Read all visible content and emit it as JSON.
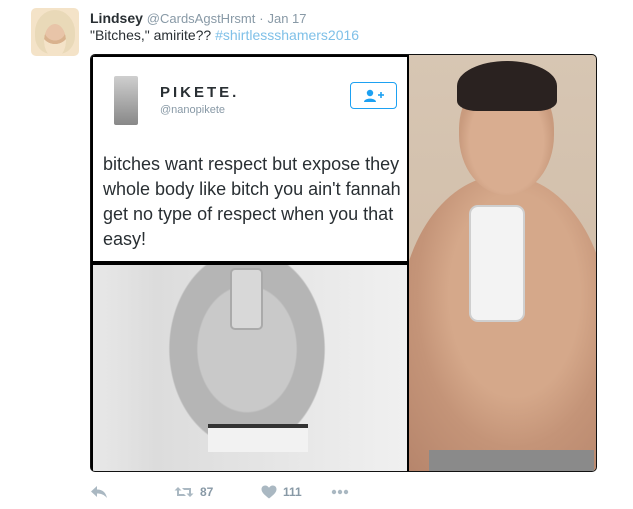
{
  "tweet": {
    "display_name": "Lindsey",
    "handle": "@CardsAgstHrsmt",
    "separator": "·",
    "date": "Jan 17",
    "text": "\"Bitches,\" amirite??",
    "hashtag": "#shirtlessshamers2016"
  },
  "quoted_tweet": {
    "name": "PIKETE.",
    "handle": "@nanopikete",
    "text": "bitches want respect but expose they whole body like bitch you ain't fannah get no type of respect when you that easy!"
  },
  "actions": {
    "retweet_count": "87",
    "like_count": "111"
  },
  "colors": {
    "accent": "#1da1f2",
    "hashtag": "#7fc0e8",
    "muted": "#8899a6",
    "text": "#292f33"
  },
  "icons": [
    "reply-icon",
    "retweet-icon",
    "heart-icon",
    "more-icon",
    "follow-icon"
  ]
}
